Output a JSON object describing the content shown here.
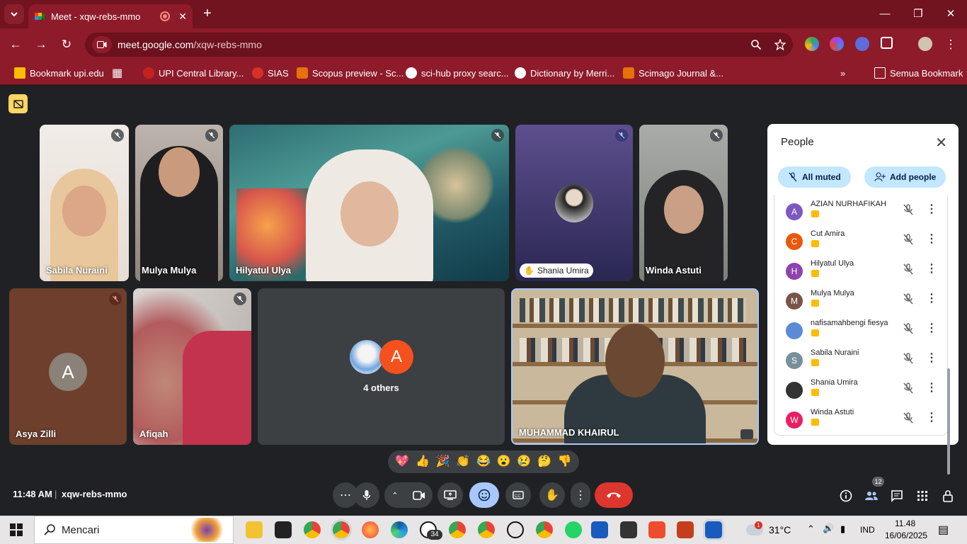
{
  "browser": {
    "tab_title": "Meet - xqw-rebs-mmo",
    "url_domain": "meet.google.com",
    "url_path": "/xqw-rebs-mmo"
  },
  "bookmarks": [
    {
      "label": "Bookmark upi.edu",
      "color": "#fbbc04"
    },
    {
      "label": "UPI Central Library...",
      "color": "#c5221f"
    },
    {
      "label": "SIAS",
      "color": "#d93025"
    },
    {
      "label": "Scopus preview - Sc...",
      "color": "#e8710a"
    },
    {
      "label": "sci-hub proxy searc...",
      "color": "#ffffff"
    },
    {
      "label": "Dictionary by Merri...",
      "color": "#ffffff"
    },
    {
      "label": "Scimago Journal &...",
      "color": "#e8710a"
    }
  ],
  "bookmarks_all": "Semua Bookmark",
  "tiles": {
    "sabila": "Sabila Nuraini",
    "mulya": "Mulya Mulya",
    "hilyatul": "Hilyatul Ulya",
    "shania": "Shania Umira",
    "winda": "Winda Astuti",
    "asya": "Asya Zilli",
    "asya_initial": "A",
    "afiqah": "Afiqah",
    "others": "4 others",
    "others_initial": "A",
    "muhammad": "MUHAMMAD KHAIRUL"
  },
  "people_panel": {
    "title": "People",
    "all_muted": "All muted",
    "add_people": "Add people",
    "participants": [
      {
        "initial": "A",
        "name": "AZIAN NURHAFIKAH",
        "color": "#7e57c2"
      },
      {
        "initial": "C",
        "name": "Cut Amira",
        "color": "#e8590c"
      },
      {
        "initial": "H",
        "name": "Hilyatul Ulya",
        "color": "#8e44ad"
      },
      {
        "initial": "M",
        "name": "Mulya Mulya",
        "color": "#795548"
      },
      {
        "initial": "",
        "name": "nafisamahbengi fiesya",
        "color": "#5b8bd6"
      },
      {
        "initial": "S",
        "name": "Sabila Nuraini",
        "color": "#78909c"
      },
      {
        "initial": "",
        "name": "Shania Umira",
        "color": "#333333"
      },
      {
        "initial": "W",
        "name": "Winda Astuti",
        "color": "#e91e63"
      }
    ]
  },
  "reactions": [
    "💖",
    "👍",
    "🎉",
    "👏",
    "😂",
    "😮",
    "😢",
    "🤔",
    "👎"
  ],
  "meeting": {
    "time": "11:48 AM",
    "code": "xqw-rebs-mmo",
    "people_count": "12"
  },
  "taskbar": {
    "search_placeholder": "Mencari",
    "whatsapp_badge": "34",
    "weather_badge": "1",
    "temperature": "31°C",
    "language": "IND",
    "time": "11.48",
    "date": "16/06/2025"
  }
}
